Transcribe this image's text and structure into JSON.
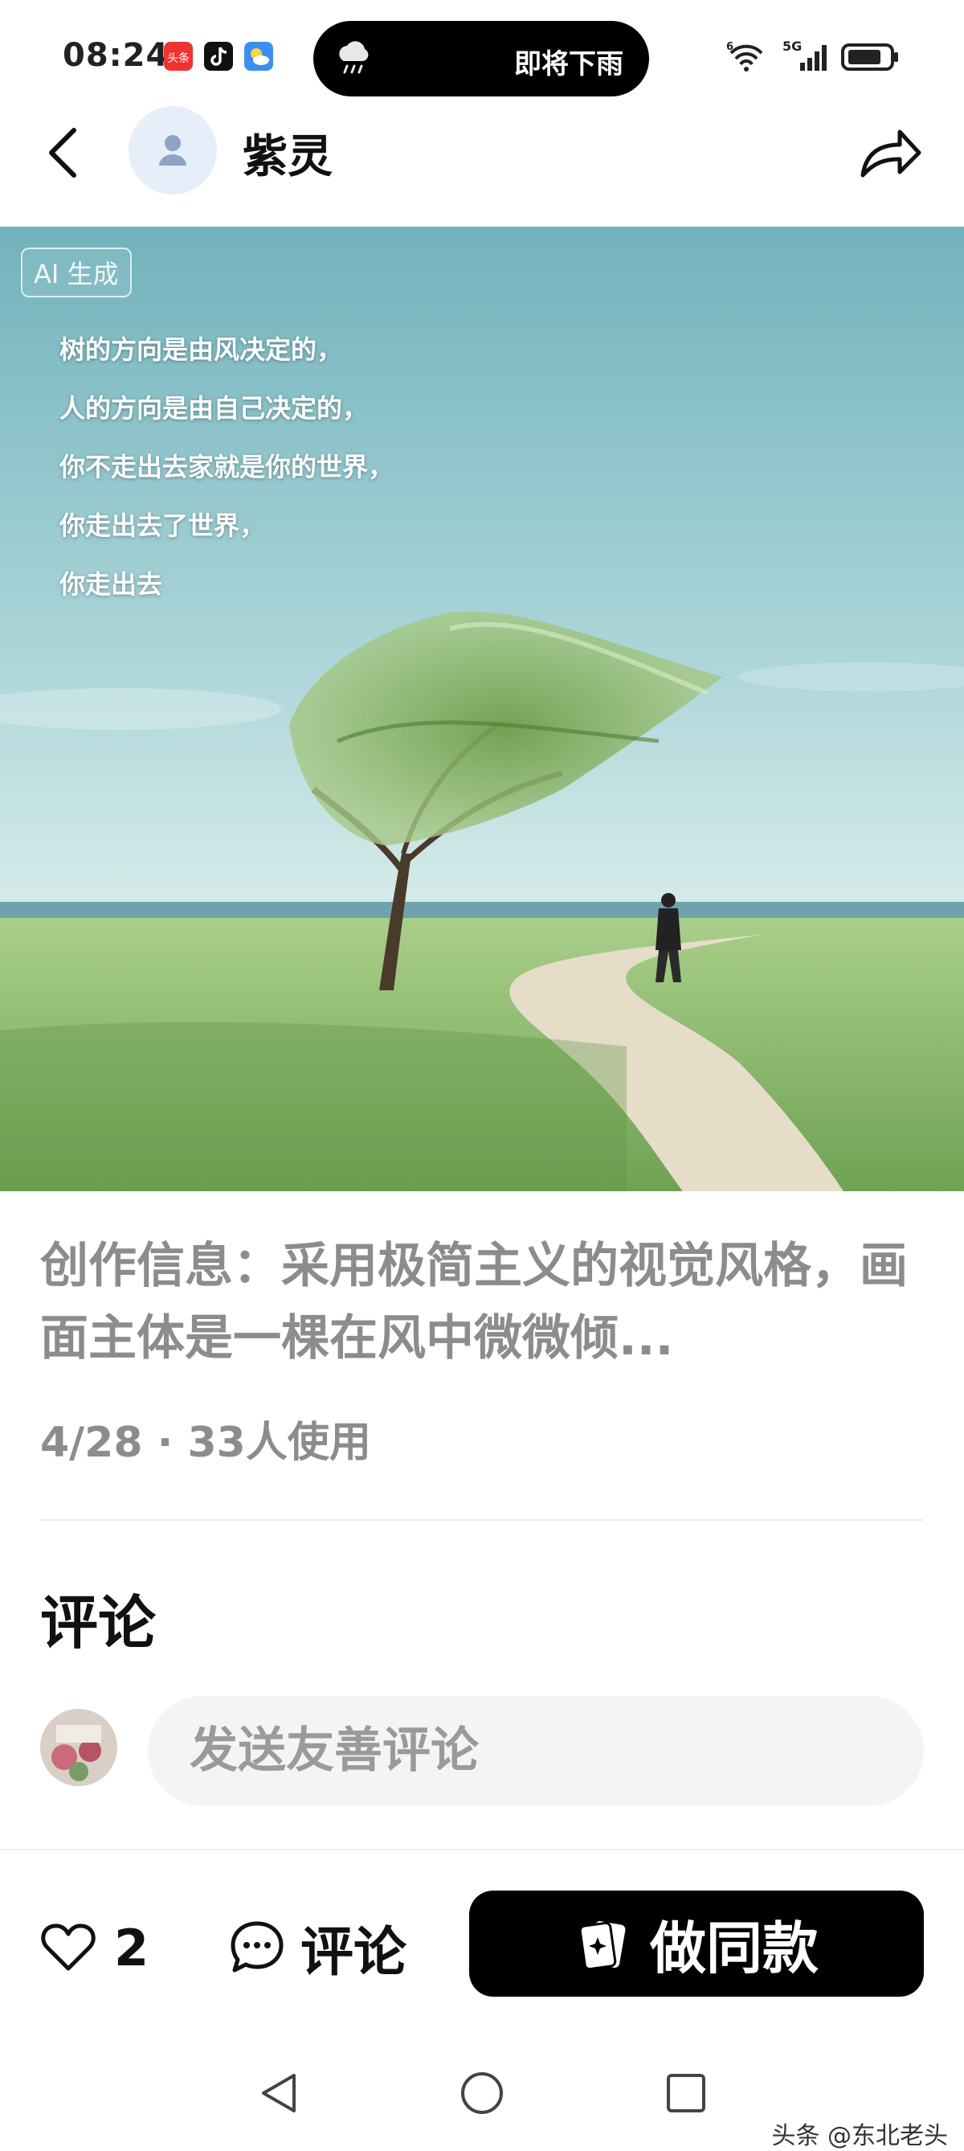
{
  "status_bar": {
    "time": "08:24",
    "app_icons": [
      "toutiao-icon",
      "douyin-icon",
      "weather-icon"
    ],
    "island_text": "即将下雨",
    "network_label": "5G"
  },
  "header": {
    "back_icon": "chevron-left-icon",
    "author": "紫灵",
    "share_icon": "share-icon"
  },
  "image": {
    "badge": "AI 生成",
    "poem_lines": [
      "树的方向是由风决定的，",
      "人的方向是由自己决定的，",
      "你不走出去家就是你的世界，",
      "你走出去了世界，",
      "你走出去"
    ]
  },
  "info": {
    "description": "创作信息：采用极简主义的视觉风格，画面主体是一棵在风中微微倾...",
    "meta": "4/28 · 33人使用"
  },
  "comments": {
    "title": "评论",
    "input_placeholder": "发送友善评论"
  },
  "actions": {
    "like_count": "2",
    "comment_label": "评论",
    "make_label": "做同款"
  },
  "watermark": "头条 @东北老头",
  "colors": {
    "accent_button": "#000000",
    "muted_text": "#8c8c8c",
    "sky_top": "#7ab7c0",
    "grass": "#8fbf6a"
  }
}
